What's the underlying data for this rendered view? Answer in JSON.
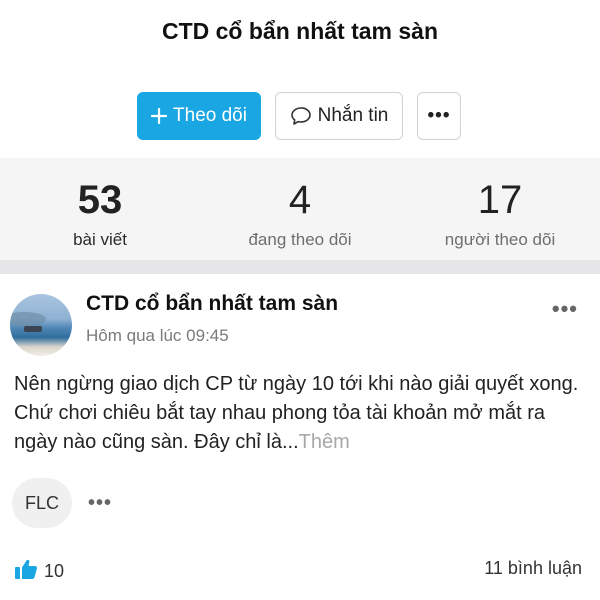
{
  "profile": {
    "name": "CTD cổ bẩn nhất tam sàn"
  },
  "actions": {
    "follow_label": "Theo dõi",
    "message_label": "Nhắn tin",
    "more_label": "•••"
  },
  "stats": [
    {
      "value": "53",
      "label": "bài viết"
    },
    {
      "value": "4",
      "label": "đang theo dõi"
    },
    {
      "value": "17",
      "label": "người theo dõi"
    }
  ],
  "post": {
    "author": "CTD cổ bẩn nhất tam sàn",
    "time": "Hôm qua lúc 09:45",
    "more_label": "•••",
    "body": "Nên ngừng giao dịch CP từ ngày 10 tới khi nào giải quyết xong. Chứ chơi chiêu bắt tay nhau phong tỏa tài khoản mở mắt ra ngày nào cũng sàn. Đây chỉ là...",
    "read_more": "Thêm",
    "tags": [
      "FLC"
    ],
    "tags_more": "•••",
    "likes": "10",
    "comments": "11 bình luận"
  },
  "colors": {
    "accent": "#1aa6e3",
    "stats_bg": "#f5f5f6",
    "divider": "#e6e6e8"
  },
  "icons": {
    "follow": "plus-icon",
    "message": "chat-bubble-icon",
    "like": "thumbs-up-icon",
    "avatar": "beach-photo"
  }
}
